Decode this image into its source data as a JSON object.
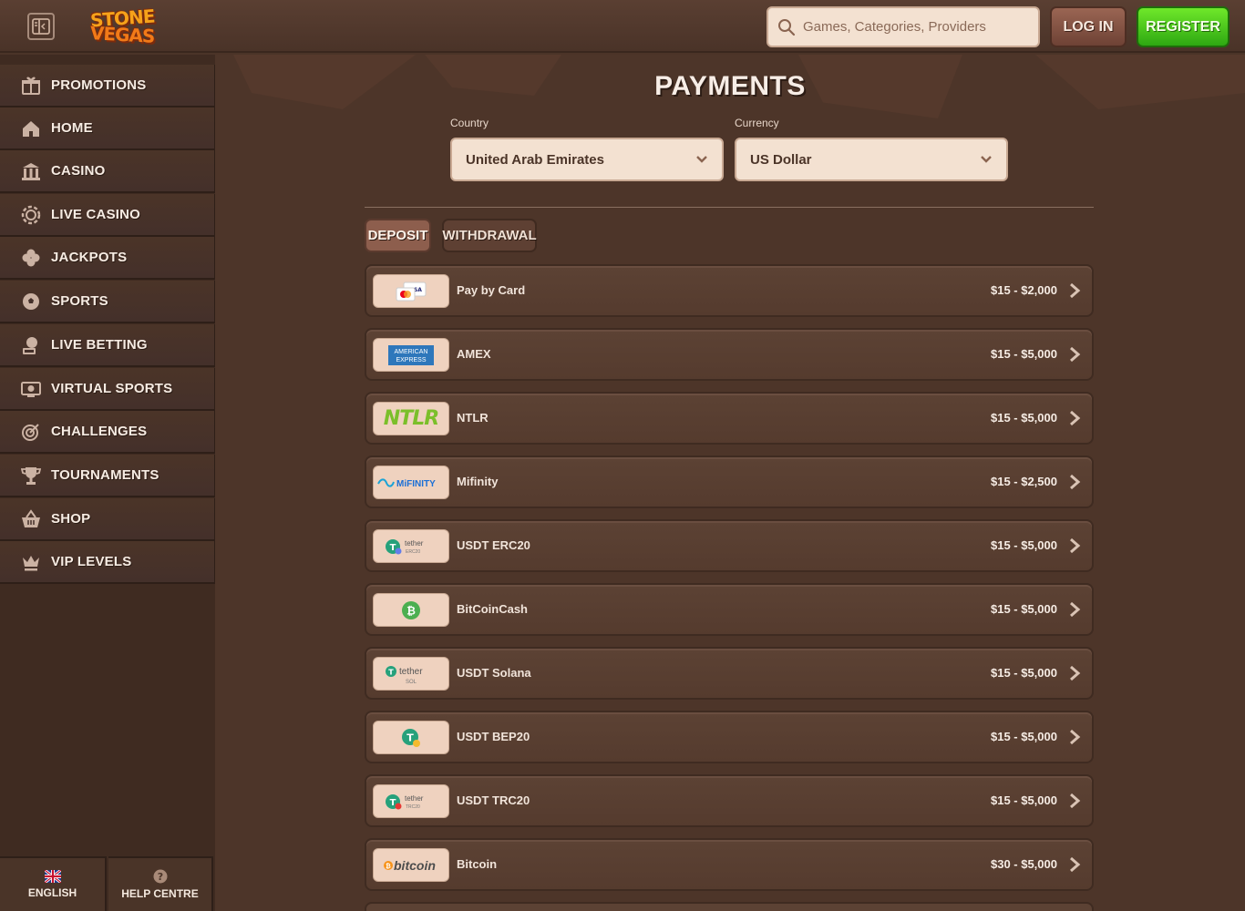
{
  "header": {
    "logo_line1": "STONE",
    "logo_line2": "VEGAS",
    "search_placeholder": "Games, Categories, Providers",
    "login_label": "LOG IN",
    "register_label": "REGISTER"
  },
  "sidebar": {
    "items": [
      {
        "label": "PROMOTIONS",
        "icon": "gift-chest-icon"
      },
      {
        "label": "HOME",
        "icon": "home-icon"
      },
      {
        "label": "CASINO",
        "icon": "casino-building-icon"
      },
      {
        "label": "LIVE CASINO",
        "icon": "chip-icon"
      },
      {
        "label": "JACKPOTS",
        "icon": "clover-icon"
      },
      {
        "label": "SPORTS",
        "icon": "soccer-ball-icon"
      },
      {
        "label": "LIVE BETTING",
        "icon": "live-betting-icon"
      },
      {
        "label": "VIRTUAL SPORTS",
        "icon": "virtual-sports-icon"
      },
      {
        "label": "CHALLENGES",
        "icon": "target-icon"
      },
      {
        "label": "TOURNAMENTS",
        "icon": "trophy-icon"
      },
      {
        "label": "SHOP",
        "icon": "basket-icon"
      },
      {
        "label": "VIP LEVELS",
        "icon": "crown-icon"
      }
    ],
    "language_label": "ENGLISH",
    "help_label": "HELP CENTRE"
  },
  "main": {
    "title": "PAYMENTS",
    "country_label": "Country",
    "country_value": "United Arab Emirates",
    "currency_label": "Currency",
    "currency_value": "US Dollar",
    "tabs": [
      {
        "label": "DEPOSIT",
        "active": true
      },
      {
        "label": "WITHDRAWAL",
        "active": false
      }
    ],
    "payments": [
      {
        "name": "Pay by Card",
        "range": "$15 - $2,000",
        "logo": "card-logo"
      },
      {
        "name": "AMEX",
        "range": "$15 - $5,000",
        "logo": "amex-logo"
      },
      {
        "name": "NTLR",
        "range": "$15 - $5,000",
        "logo": "ntlr-logo"
      },
      {
        "name": "Mifinity",
        "range": "$15 - $2,500",
        "logo": "mifinity-logo"
      },
      {
        "name": "USDT ERC20",
        "range": "$15 - $5,000",
        "logo": "tether-erc20-logo"
      },
      {
        "name": "BitCoinCash",
        "range": "$15 - $5,000",
        "logo": "bitcoincash-logo"
      },
      {
        "name": "USDT Solana",
        "range": "$15 - $5,000",
        "logo": "tether-sol-logo"
      },
      {
        "name": "USDT BEP20",
        "range": "$15 - $5,000",
        "logo": "tether-bep20-logo"
      },
      {
        "name": "USDT TRC20",
        "range": "$15 - $5,000",
        "logo": "tether-trc20-logo"
      },
      {
        "name": "Bitcoin",
        "range": "$30 - $5,000",
        "logo": "bitcoin-logo"
      }
    ],
    "logo_text": {
      "visa": "VISA",
      "amex_line1": "AMERICAN",
      "amex_line2": "EXPRESS",
      "ntlr": "NTLR",
      "mifinity": "MiFINITY",
      "tether": "tether",
      "erc20": "ERC20",
      "sol": "SOL",
      "trc20": "TRC20",
      "bitcoin": "bitcoin"
    }
  }
}
